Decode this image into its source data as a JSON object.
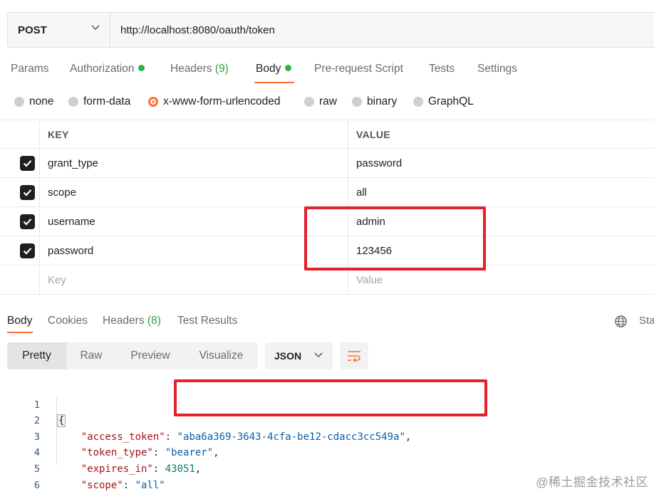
{
  "request": {
    "method": "POST",
    "url": "http://localhost:8080/oauth/token"
  },
  "request_tabs": {
    "params": "Params",
    "authorization": "Authorization",
    "headers": "Headers",
    "headers_count": "(9)",
    "body": "Body",
    "prerequest": "Pre-request Script",
    "tests": "Tests",
    "settings": "Settings"
  },
  "body_types": {
    "none": "none",
    "form_data": "form-data",
    "urlencoded": "x-www-form-urlencoded",
    "raw": "raw",
    "binary": "binary",
    "graphql": "GraphQL",
    "selected": "x-www-form-urlencoded"
  },
  "params_table": {
    "key_header": "KEY",
    "value_header": "VALUE",
    "rows": [
      {
        "key": "grant_type",
        "value": "password",
        "checked": true
      },
      {
        "key": "scope",
        "value": "all",
        "checked": true
      },
      {
        "key": "username",
        "value": "admin",
        "checked": true
      },
      {
        "key": "password",
        "value": "123456",
        "checked": true
      }
    ],
    "key_placeholder": "Key",
    "value_placeholder": "Value"
  },
  "response_tabs": {
    "body": "Body",
    "cookies": "Cookies",
    "headers": "Headers",
    "headers_count": "(8)",
    "test_results": "Test Results",
    "status_cut": "Sta"
  },
  "response_view": {
    "pretty": "Pretty",
    "raw": "Raw",
    "preview": "Preview",
    "visualize": "Visualize",
    "format": "JSON"
  },
  "response_body": {
    "line_numbers": [
      "1",
      "2",
      "3",
      "4",
      "5",
      "6"
    ],
    "open_brace": "{",
    "close_brace": "}",
    "access_token_key": "\"access_token\"",
    "access_token_value": "\"aba6a369-3643-4cfa-be12-cdacc3cc549a\"",
    "token_type_key": "\"token_type\"",
    "token_type_value": "\"bearer\"",
    "expires_in_key": "\"expires_in\"",
    "expires_in_value": "43051",
    "scope_key": "\"scope\"",
    "scope_value": "\"all\""
  },
  "watermark": "@稀土掘金技术社区",
  "colors": {
    "accent": "#ff6c37",
    "status_dot": "#26b543",
    "highlight": "#e3202b"
  }
}
